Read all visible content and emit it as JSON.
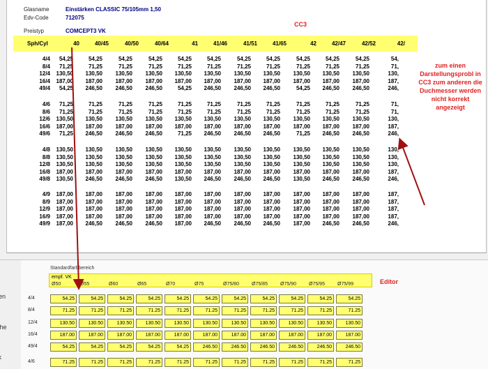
{
  "header": {
    "glasname_label": "Glasname",
    "glasname_value": "Einstärken CLASSIC 75/105mm 1,50",
    "edv_label": "Edv-Code",
    "edv_value": "712075",
    "preistyp_label": "Preistyp",
    "preistyp_value": "COMCEPT3 VK",
    "tag": "CC3"
  },
  "cc3_table": {
    "corner": "Sph/Cyl",
    "columns": [
      "40",
      "40/45",
      "40/50",
      "40/64",
      "41",
      "41/46",
      "41/51",
      "41/65",
      "42",
      "42/47",
      "42/52",
      "42/"
    ],
    "groups": [
      [
        {
          "label": "4/4",
          "cells": [
            "54,25",
            "54,25",
            "54,25",
            "54,25",
            "54,25",
            "54,25",
            "54,25",
            "54,25",
            "54,25",
            "54,25",
            "54,25",
            "54,"
          ]
        },
        {
          "label": "8/4",
          "cells": [
            "71,25",
            "71,25",
            "71,25",
            "71,25",
            "71,25",
            "71,25",
            "71,25",
            "71,25",
            "71,25",
            "71,25",
            "71,25",
            "71,"
          ]
        },
        {
          "label": "12/4",
          "cells": [
            "130,50",
            "130,50",
            "130,50",
            "130,50",
            "130,50",
            "130,50",
            "130,50",
            "130,50",
            "130,50",
            "130,50",
            "130,50",
            "130,"
          ]
        },
        {
          "label": "16/4",
          "cells": [
            "187,00",
            "187,00",
            "187,00",
            "187,00",
            "187,00",
            "187,00",
            "187,00",
            "187,00",
            "187,00",
            "187,00",
            "187,00",
            "187,"
          ]
        },
        {
          "label": "49/4",
          "cells": [
            "54,25",
            "246,50",
            "246,50",
            "246,50",
            "54,25",
            "246,50",
            "246,50",
            "246,50",
            "54,25",
            "246,50",
            "246,50",
            "246,"
          ]
        }
      ],
      [
        {
          "label": "4/6",
          "cells": [
            "71,25",
            "71,25",
            "71,25",
            "71,25",
            "71,25",
            "71,25",
            "71,25",
            "71,25",
            "71,25",
            "71,25",
            "71,25",
            "71,"
          ]
        },
        {
          "label": "8/6",
          "cells": [
            "71,25",
            "71,25",
            "71,25",
            "71,25",
            "71,25",
            "71,25",
            "71,25",
            "71,25",
            "71,25",
            "71,25",
            "71,25",
            "71,"
          ]
        },
        {
          "label": "12/6",
          "cells": [
            "130,50",
            "130,50",
            "130,50",
            "130,50",
            "130,50",
            "130,50",
            "130,50",
            "130,50",
            "130,50",
            "130,50",
            "130,50",
            "130,"
          ]
        },
        {
          "label": "16/6",
          "cells": [
            "187,00",
            "187,00",
            "187,00",
            "187,00",
            "187,00",
            "187,00",
            "187,00",
            "187,00",
            "187,00",
            "187,00",
            "187,00",
            "187,"
          ]
        },
        {
          "label": "49/6",
          "cells": [
            "71,25",
            "246,50",
            "246,50",
            "246,50",
            "71,25",
            "246,50",
            "246,50",
            "246,50",
            "71,25",
            "246,50",
            "246,50",
            "246,"
          ]
        }
      ],
      [
        {
          "label": "4/8",
          "cells": [
            "130,50",
            "130,50",
            "130,50",
            "130,50",
            "130,50",
            "130,50",
            "130,50",
            "130,50",
            "130,50",
            "130,50",
            "130,50",
            "130,"
          ]
        },
        {
          "label": "8/8",
          "cells": [
            "130,50",
            "130,50",
            "130,50",
            "130,50",
            "130,50",
            "130,50",
            "130,50",
            "130,50",
            "130,50",
            "130,50",
            "130,50",
            "130,"
          ]
        },
        {
          "label": "12/8",
          "cells": [
            "130,50",
            "130,50",
            "130,50",
            "130,50",
            "130,50",
            "130,50",
            "130,50",
            "130,50",
            "130,50",
            "130,50",
            "130,50",
            "130,"
          ]
        },
        {
          "label": "16/8",
          "cells": [
            "187,00",
            "187,00",
            "187,00",
            "187,00",
            "187,00",
            "187,00",
            "187,00",
            "187,00",
            "187,00",
            "187,00",
            "187,00",
            "187,"
          ]
        },
        {
          "label": "49/8",
          "cells": [
            "130,50",
            "246,50",
            "246,50",
            "246,50",
            "130,50",
            "246,50",
            "246,50",
            "246,50",
            "130,50",
            "246,50",
            "246,50",
            "246,"
          ]
        }
      ],
      [
        {
          "label": "4/9",
          "cells": [
            "187,00",
            "187,00",
            "187,00",
            "187,00",
            "187,00",
            "187,00",
            "187,00",
            "187,00",
            "187,00",
            "187,00",
            "187,00",
            "187,"
          ]
        },
        {
          "label": "8/9",
          "cells": [
            "187,00",
            "187,00",
            "187,00",
            "187,00",
            "187,00",
            "187,00",
            "187,00",
            "187,00",
            "187,00",
            "187,00",
            "187,00",
            "187,"
          ]
        },
        {
          "label": "12/9",
          "cells": [
            "187,00",
            "187,00",
            "187,00",
            "187,00",
            "187,00",
            "187,00",
            "187,00",
            "187,00",
            "187,00",
            "187,00",
            "187,00",
            "187,"
          ]
        },
        {
          "label": "16/9",
          "cells": [
            "187,00",
            "187,00",
            "187,00",
            "187,00",
            "187,00",
            "187,00",
            "187,00",
            "187,00",
            "187,00",
            "187,00",
            "187,00",
            "187,"
          ]
        },
        {
          "label": "49/9",
          "cells": [
            "187,00",
            "246,50",
            "246,50",
            "246,50",
            "187,00",
            "246,50",
            "246,50",
            "246,50",
            "187,00",
            "246,50",
            "246,50",
            "246,"
          ]
        }
      ]
    ]
  },
  "note": "zum einen Darstellungsprobl in CC3 zum anderen die Duchmesser werden nicht korrekt angezeigt",
  "side_pane": [
    "ngen",
    "eiche",
    "ock"
  ],
  "editor": {
    "standard_label": "Standardfarbbereich",
    "empf_label": "empf. VK",
    "tag": "Editor",
    "columns": [
      "Ø50",
      "Ø55",
      "Ø60",
      "Ø65",
      "Ø70",
      "Ø75",
      "Ø75/80",
      "Ø75/85",
      "Ø75/90",
      "Ø75/95",
      "Ø75/99"
    ],
    "rows": [
      {
        "label": "4/4",
        "cells": [
          "54.25",
          "54.25",
          "54.25",
          "54.25",
          "54.25",
          "54.25",
          "54.25",
          "54.25",
          "54.25",
          "54.25",
          "54.25"
        ]
      },
      {
        "label": "8/4",
        "cells": [
          "71.25",
          "71.25",
          "71.25",
          "71.25",
          "71.25",
          "71.25",
          "71.25",
          "71.25",
          "71.25",
          "71.25",
          "71.25"
        ]
      },
      {
        "label": "12/4",
        "cells": [
          "130.50",
          "130.50",
          "130.50",
          "130.50",
          "130.50",
          "130.50",
          "130.50",
          "130.50",
          "130.50",
          "130.50",
          "130.50"
        ]
      },
      {
        "label": "16/4",
        "cells": [
          "187.00",
          "187.00",
          "187.00",
          "187.00",
          "187.00",
          "187.00",
          "187.00",
          "187.00",
          "187.00",
          "187.00",
          "187.00"
        ]
      },
      {
        "label": "49/4",
        "cells": [
          "54.25",
          "54.25",
          "54.25",
          "54.25",
          "54.25",
          "246.50",
          "246.50",
          "246.50",
          "246.50",
          "246.50",
          "246.50"
        ]
      },
      {
        "label": "4/6",
        "cells": [
          "71.25",
          "71.25",
          "71.25",
          "71.25",
          "71.25",
          "71.25",
          "71.25",
          "71.25",
          "71.25",
          "71.25",
          "71.25"
        ]
      }
    ]
  },
  "colors": {
    "highlight": "#ffff70",
    "annotation": "#e02020",
    "header_value": "#000080",
    "arrow": "#a01010"
  }
}
